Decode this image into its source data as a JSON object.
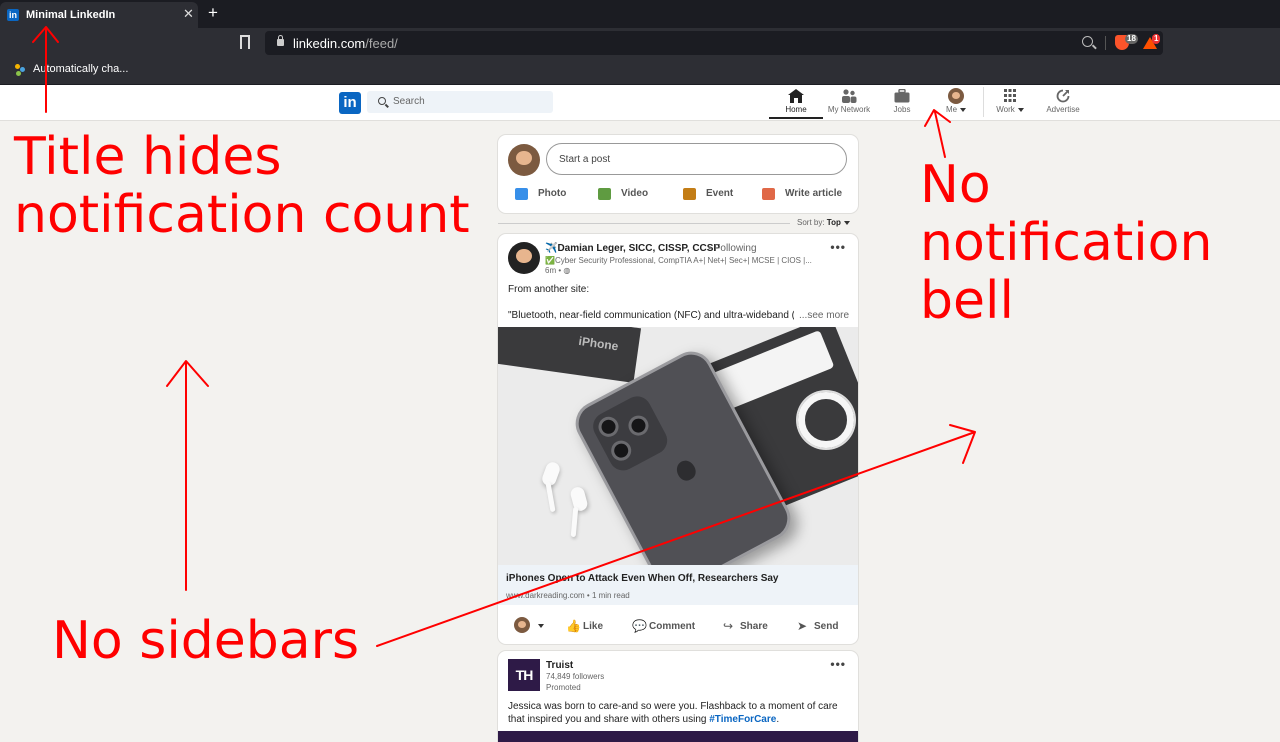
{
  "browser": {
    "tab_title": "Minimal LinkedIn",
    "tab_favicon": "in",
    "tab_close": "✕",
    "new_tab": "+",
    "url_domain": "linkedin.com",
    "url_path": "/feed/",
    "ext_badge_brave": "18",
    "ext_badge_alert": "1",
    "bookmark_label": "Automatically cha..."
  },
  "li_nav": {
    "logo": "in",
    "search_placeholder": "Search",
    "items": [
      {
        "label": "Home",
        "icon": "home-icon"
      },
      {
        "label": "My Network",
        "icon": "network-icon"
      },
      {
        "label": "Jobs",
        "icon": "briefcase-icon"
      },
      {
        "label": "Me",
        "icon": "avatar"
      },
      {
        "label": "Work",
        "icon": "grid-icon"
      },
      {
        "label": "Advertise",
        "icon": "advertise-icon"
      }
    ]
  },
  "share_box": {
    "placeholder": "Start a post",
    "actions": [
      {
        "label": "Photo",
        "color": "#378fe9"
      },
      {
        "label": "Video",
        "color": "#5f9b41"
      },
      {
        "label": "Event",
        "color": "#c37d16"
      },
      {
        "label": "Write article",
        "color": "#e06847"
      }
    ]
  },
  "sort": {
    "prefix": "Sort by: ",
    "value": "Top"
  },
  "post": {
    "author": "✈️Damian Leger, SICC, CISSP, CCSP",
    "following": "• Following",
    "headline": "✅Cyber Security Professional, CompTIA A+| Net+| Sec+| MCSE | CIOS |...",
    "time": "6m •",
    "text1": "From another site:",
    "text2": "\"Bluetooth, near-field communication (NFC) and ultra-wideband (U",
    "see_more": "...see more",
    "image_text": "iPhone",
    "link_title": "iPhones Open to Attack Even When Off, Researchers Say",
    "link_meta": "www.darkreading.com • 1 min read",
    "actions": [
      {
        "label": "Like",
        "icon": "👍"
      },
      {
        "label": "Comment",
        "icon": "💬"
      },
      {
        "label": "Share",
        "icon": "↪"
      },
      {
        "label": "Send",
        "icon": "➤"
      }
    ]
  },
  "promo": {
    "logo": "TH",
    "name": "Truist",
    "followers": "74,849 followers",
    "promoted": "Promoted",
    "text": "Jessica was born to care-and so were you. Flashback to a moment of care that inspired you and share with others using ",
    "hashtag": "#TimeForCare",
    "text_end": "."
  },
  "annotations": {
    "title": "Title hides notification count",
    "bell": "No notification bell",
    "sidebars": "No sidebars",
    "color": "#ff0000"
  }
}
